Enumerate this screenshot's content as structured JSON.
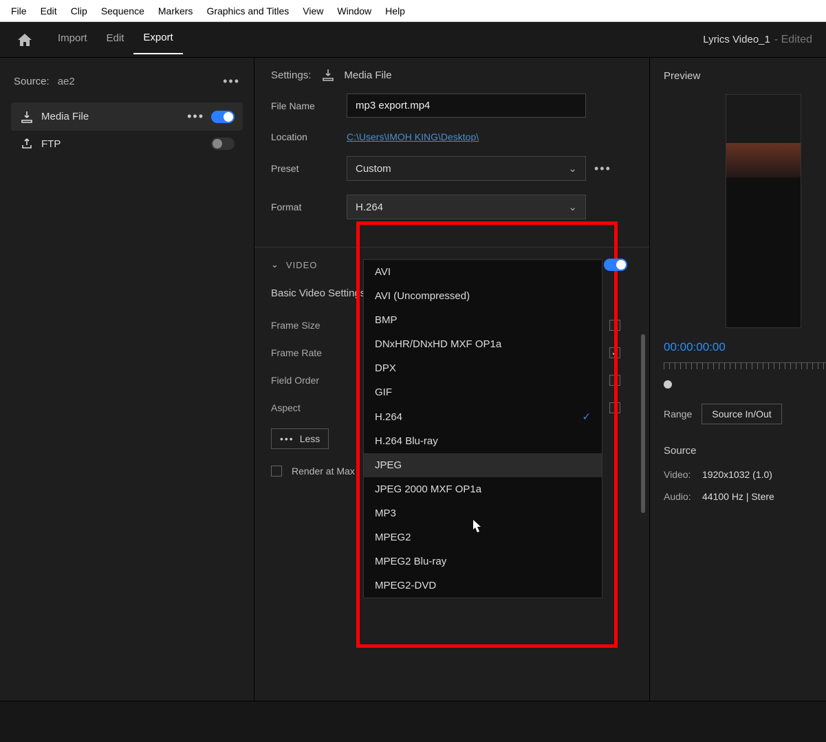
{
  "os_menu": [
    "File",
    "Edit",
    "Clip",
    "Sequence",
    "Markers",
    "Graphics and Titles",
    "View",
    "Window",
    "Help"
  ],
  "header": {
    "tabs": [
      "Import",
      "Edit",
      "Export"
    ],
    "active_tab": 2,
    "project_name": "Lyrics Video_1",
    "edited_suffix": "- Edited"
  },
  "left": {
    "source_label": "Source:",
    "source_value": "ae2",
    "destinations": [
      {
        "label": "Media File",
        "active": true,
        "toggle": true,
        "show_ellipsis": true,
        "icon": "download"
      },
      {
        "label": "FTP",
        "active": false,
        "toggle": false,
        "show_ellipsis": false,
        "icon": "share"
      }
    ]
  },
  "center": {
    "settings_label": "Settings:",
    "settings_target": "Media File",
    "file_name_label": "File Name",
    "file_name_value": "mp3 export.mp4",
    "location_label": "Location",
    "location_value": "C:\\Users\\IMOH KING\\Desktop\\",
    "preset_label": "Preset",
    "preset_value": "Custom",
    "format_label": "Format",
    "format_value": "H.264",
    "format_options": [
      {
        "label": "AVI"
      },
      {
        "label": "AVI (Uncompressed)"
      },
      {
        "label": "BMP"
      },
      {
        "label": "DNxHR/DNxHD MXF OP1a"
      },
      {
        "label": "DPX"
      },
      {
        "label": "GIF"
      },
      {
        "label": "H.264",
        "selected": true
      },
      {
        "label": "H.264 Blu-ray"
      },
      {
        "label": "JPEG",
        "hovered": true
      },
      {
        "label": "JPEG 2000 MXF OP1a"
      },
      {
        "label": "MP3"
      },
      {
        "label": "MPEG2"
      },
      {
        "label": "MPEG2 Blu-ray"
      },
      {
        "label": "MPEG2-DVD"
      }
    ],
    "video_section_title": "VIDEO",
    "video_toggle": true,
    "basic_settings_title": "Basic Video Settings",
    "fields": [
      {
        "label": "Frame Size",
        "checked": false
      },
      {
        "label": "Frame Rate",
        "checked": true
      },
      {
        "label": "Field Order",
        "checked": false
      },
      {
        "label": "Aspect",
        "checked": false
      }
    ],
    "less_label": "Less",
    "render_label": "Render at Max"
  },
  "right": {
    "preview_label": "Preview",
    "timecode": "00:00:00:00",
    "range_label": "Range",
    "range_value": "Source In/Out",
    "source_label": "Source",
    "video_key": "Video:",
    "video_val": "1920x1032 (1.0)",
    "audio_key": "Audio:",
    "audio_val": "44100 Hz | Stere"
  }
}
